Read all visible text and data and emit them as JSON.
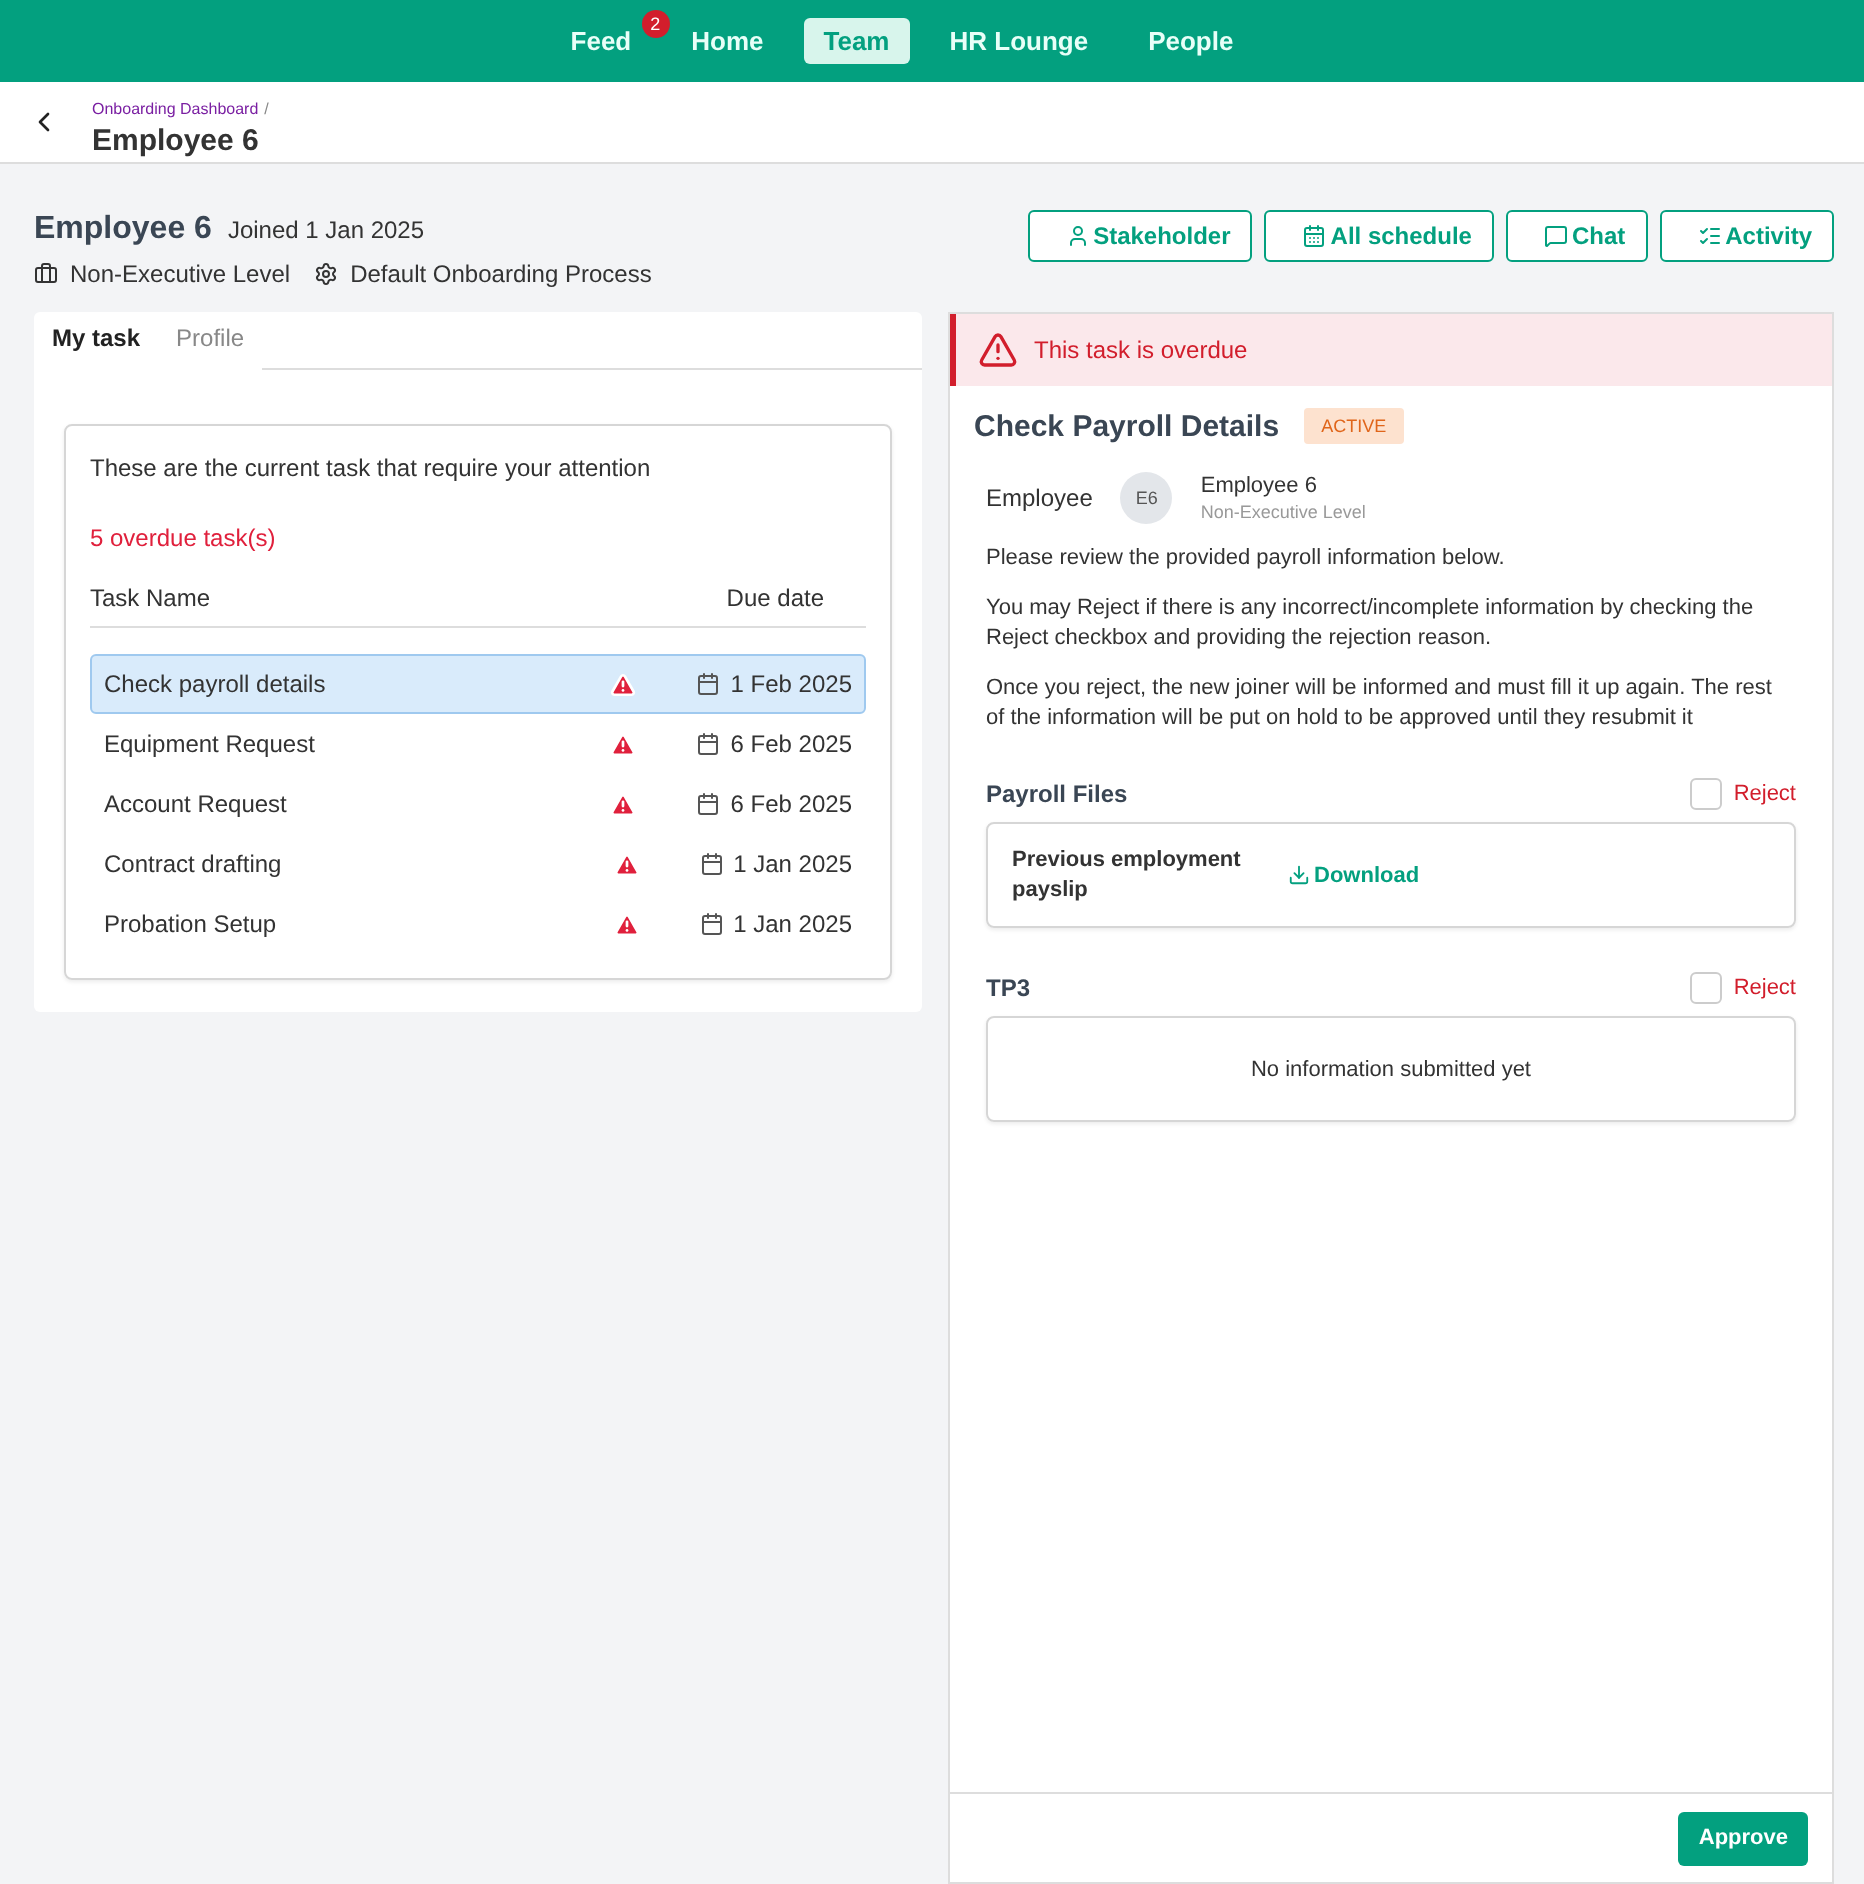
{
  "nav": [
    {
      "label": "Feed",
      "selected": false,
      "badge": "2"
    },
    {
      "label": "Home",
      "selected": false
    },
    {
      "label": "Team",
      "selected": true
    },
    {
      "label": "HR Lounge",
      "selected": false
    },
    {
      "label": "People",
      "selected": false
    }
  ],
  "breadcrumb": "Onboarding Dashboard",
  "breadcrumb_separator": "/",
  "page_title": "Employee 6",
  "employee": {
    "name": "Employee 6",
    "joined": "Joined 1 Jan 2025",
    "level": "Non-Executive Level",
    "process": "Default Onboarding Process"
  },
  "actions": [
    "Stakeholder",
    "All schedule",
    "Chat",
    "Activity"
  ],
  "tabs": [
    {
      "label": "My task",
      "selected": true
    },
    {
      "label": "Profile",
      "selected": false
    }
  ],
  "task_card": {
    "intro": "These are the current task that require your attention",
    "overdue": "5 overdue task(s)",
    "columns": [
      "Task Name",
      "Due date"
    ],
    "rows": [
      {
        "name": "Check payroll details",
        "due": "1 Feb 2025",
        "overdue": true,
        "selected": true
      },
      {
        "name": "Equipment Request",
        "due": "6 Feb 2025",
        "overdue": true,
        "selected": false
      },
      {
        "name": "Account Request",
        "due": "6 Feb 2025",
        "overdue": true,
        "selected": false
      },
      {
        "name": "Contract drafting",
        "due": "1 Jan 2025",
        "overdue": true,
        "selected": false
      },
      {
        "name": "Probation Setup",
        "due": "1 Jan 2025",
        "overdue": true,
        "selected": false
      }
    ]
  },
  "detail": {
    "alert": "This task is overdue",
    "title": "Check Payroll Details",
    "status": "ACTIVE",
    "employee_label": "Employee",
    "avatar": "E6",
    "employee_name": "Employee 6",
    "employee_level": "Non-Executive Level",
    "paragraphs": [
      "Please review the provided payroll information below.",
      "You may Reject if there is any incorrect/incomplete information by checking the Reject checkbox and providing the rejection reason.",
      "Once you reject, the new joiner will be informed and must fill it up again. The rest of the information will be put on hold to be approved until they resubmit it"
    ],
    "sections": [
      {
        "title": "Payroll Files",
        "reject": "Reject",
        "checked": false,
        "kind": "file",
        "file": "Previous employment payslip",
        "link": "Download"
      },
      {
        "title": "TP3",
        "reject": "Reject",
        "checked": false,
        "kind": "empty",
        "message": "No information submitted yet"
      }
    ],
    "approve": "Approve"
  }
}
